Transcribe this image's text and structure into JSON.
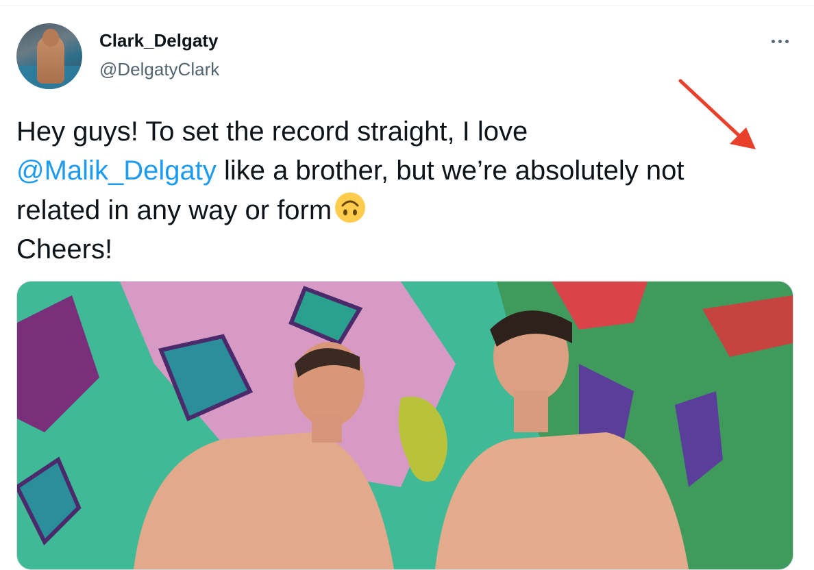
{
  "tweet": {
    "display_name": "Clark_Delgaty",
    "handle": "@DelgatyClark",
    "text_line1": "Hey guys! To set the record straight, I love",
    "mention": "@Malik_Delgaty",
    "text_line2_rest": " like a brother, but we’re absolutely not",
    "text_line3": "related in any way or form",
    "text_line4": "Cheers!"
  },
  "icons": {
    "more": "more-horizontal-icon",
    "emoji": "upside-down-face-emoji",
    "annotation": "red-arrow-annotation"
  },
  "colors": {
    "text": "#0f1419",
    "secondary": "#536471",
    "mention": "#1d9bf0",
    "annotation_red": "#e8402a"
  }
}
